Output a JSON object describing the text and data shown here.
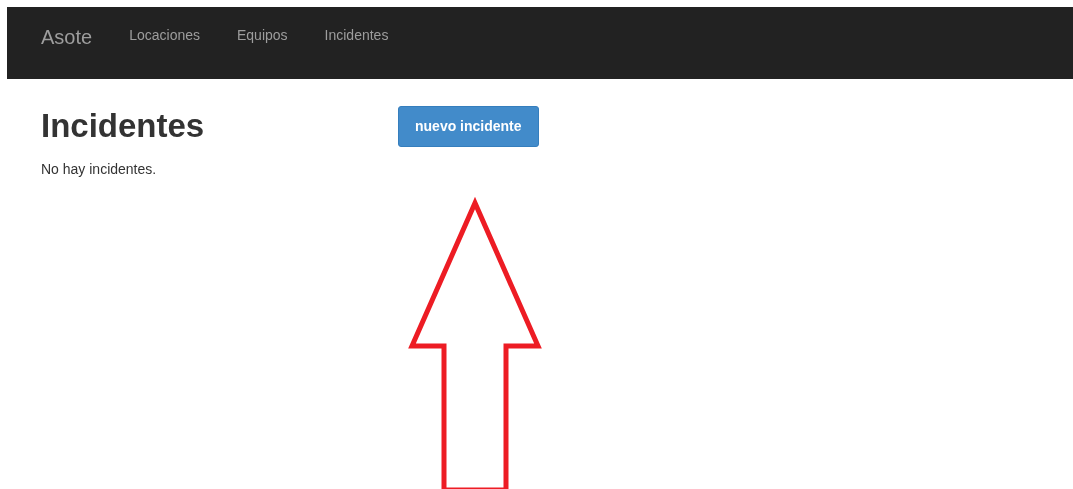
{
  "navbar": {
    "brand": "Asote",
    "links": [
      {
        "label": "Locaciones",
        "selected": false
      },
      {
        "label": "Equipos",
        "selected": false
      },
      {
        "label": "Incidentes",
        "selected": false
      }
    ]
  },
  "page": {
    "title": "Incidentes",
    "button": "nuevo incidente",
    "message": "No hay incidentes."
  }
}
